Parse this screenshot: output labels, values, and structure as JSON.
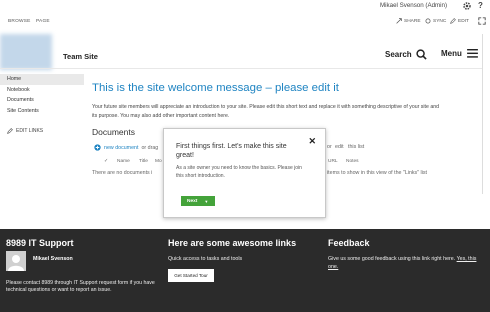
{
  "suitebar": {
    "user": "Mikael Svenson (Admin)"
  },
  "ribbon": {
    "tabs": [
      "BROWSE",
      "PAGE"
    ],
    "actions": [
      "SHARE",
      "SYNC",
      "EDIT"
    ]
  },
  "header": {
    "site_title": "Team Site",
    "search_label": "Search",
    "menu_label": "Menu"
  },
  "quick_launch": {
    "items": [
      "Home",
      "Notebook",
      "Documents",
      "Site Contents"
    ],
    "edit_links": "EDIT LINKS"
  },
  "main": {
    "welcome_title": "This is the site welcome message – please edit it",
    "intro_line1": "Your future site members will appreciate an introduction to your site. Please edit this short text and replace it with something descriptive of your site and",
    "intro_line2": "its purpose. You may also add other important content here.",
    "documents_title": "Documents",
    "new_document": "new document",
    "or_drag": "or drag",
    "columns": [
      "Name",
      "Title",
      "Mo"
    ],
    "no_docs": "There are no documents i",
    "right_or": "or",
    "right_edit": "edit",
    "right_this_list": "this list",
    "right_columns": [
      "URL",
      "Notes"
    ],
    "right_empty": "items to show in this view of the \"Links\" list"
  },
  "dialog": {
    "heading": "First things first. Let's make this site great!",
    "body": "As a site owner you need to know the basics. Please join this short introduction.",
    "next_label": "Next",
    "close_glyph": "✕"
  },
  "footer": {
    "support_title": "8989 IT Support",
    "contact_name": "Mikael Svenson",
    "contact_text": "Please contact 8989 through IT Support request form if you have technical questions or want to report an issue.",
    "links_title": "Here are some awesome links",
    "links_sub": "Quick access to tasks and tools",
    "tour_button": "Get Started Tour",
    "feedback_title": "Feedback",
    "feedback_text": "Give us some good feedback using this link right here.",
    "feedback_yes": "Yes, this one."
  },
  "colors": {
    "accent": "#1f84c2",
    "footer_bg": "#2b2b2b",
    "next_button": "#44a33a"
  }
}
